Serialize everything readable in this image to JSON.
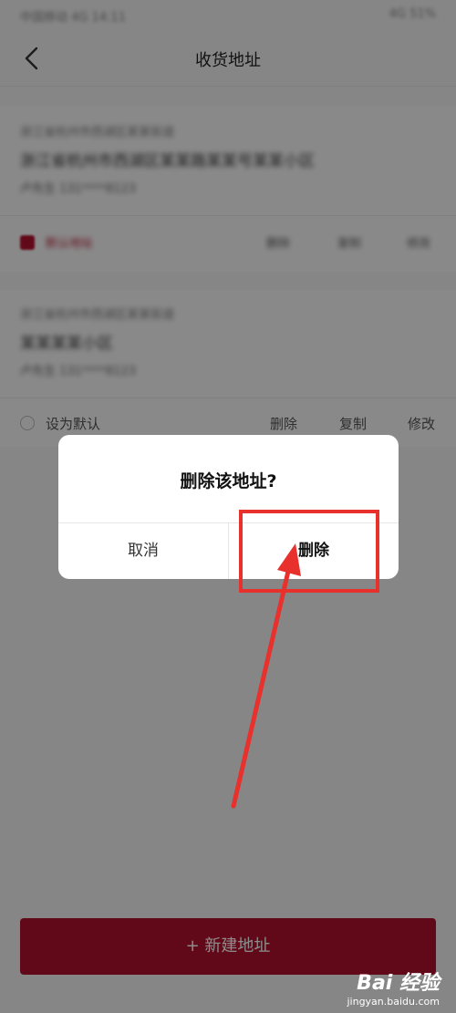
{
  "statusbar": {
    "left": "中国移动 4G 14:11",
    "right": "4G 51%"
  },
  "nav": {
    "title": "收货地址"
  },
  "addresses": [
    {
      "region": "浙江省杭州市西湖区某某街道",
      "detail": "浙江省杭州市西湖区某某路某某号某某小区",
      "contact": "卢先生 131****8123",
      "default_label": "默认地址",
      "actions": [
        "删除",
        "复制",
        "修改"
      ]
    },
    {
      "region": "浙江省杭州市西湖区某某街道",
      "detail": "某某某某小区",
      "contact": "卢先生 131****8123",
      "default_label": "设为默认",
      "actions": [
        "删除",
        "复制",
        "修改"
      ]
    }
  ],
  "new_address_button": "+ 新建地址",
  "dialog": {
    "title": "删除该地址?",
    "cancel": "取消",
    "confirm": "删除"
  },
  "watermark": {
    "logo": "Bai 经验",
    "url": "jingyan.baidu.com"
  },
  "colors": {
    "accent": "#b3122e",
    "highlight": "#e8302d"
  }
}
